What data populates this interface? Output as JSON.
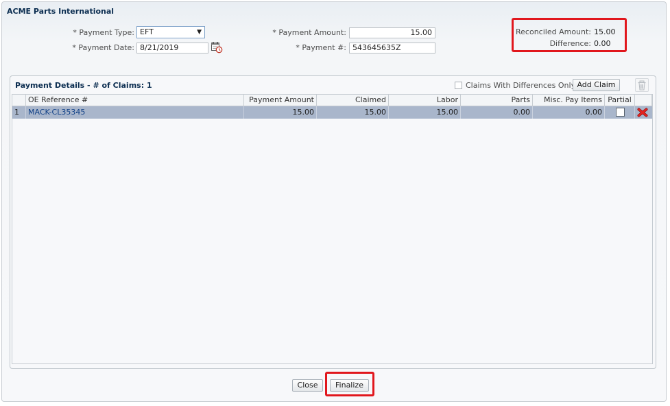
{
  "app": {
    "title": "ACME Parts International"
  },
  "form": {
    "payment_type_label": "* Payment Type:",
    "payment_type_value": "EFT",
    "payment_date_label": "* Payment Date:",
    "payment_date_value": "8/21/2019",
    "payment_amount_label": "* Payment Amount:",
    "payment_amount_value": "15.00",
    "payment_number_label": "* Payment #:",
    "payment_number_value": "543645635Z"
  },
  "reconcile": {
    "reconciled_label": "Reconciled Amount:",
    "reconciled_value": "15.00",
    "difference_label": "Difference:",
    "difference_value": "0.00"
  },
  "details": {
    "title": "Payment Details - # of Claims: 1",
    "diff_only_label": "Claims With Differences Only",
    "add_claim_label": "Add Claim",
    "columns": [
      "",
      "OE Reference #",
      "Payment Amount",
      "Claimed",
      "Labor",
      "Parts",
      "Misc. Pay Items",
      "Partial",
      ""
    ],
    "rows": [
      {
        "num": "1",
        "oe_ref": "MACK-CL35345",
        "payment_amount": "15.00",
        "claimed": "15.00",
        "labor": "15.00",
        "parts": "0.00",
        "misc": "0.00",
        "partial": false
      }
    ]
  },
  "footer": {
    "close_label": "Close",
    "finalize_label": "Finalize"
  },
  "colors": {
    "highlight": "#e1171d",
    "selected_row": "#a9b6cb",
    "title": "#0b2d50"
  },
  "icons": {
    "calendar": "calendar-clock-icon",
    "dropdown": "chevron-down-icon",
    "trash": "trash-icon",
    "delete": "red-x-icon"
  }
}
